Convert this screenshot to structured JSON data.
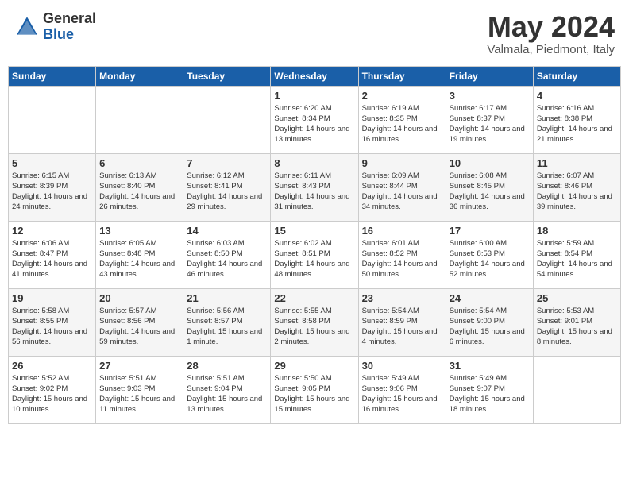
{
  "header": {
    "logo_general": "General",
    "logo_blue": "Blue",
    "month_title": "May 2024",
    "location": "Valmala, Piedmont, Italy"
  },
  "weekdays": [
    "Sunday",
    "Monday",
    "Tuesday",
    "Wednesday",
    "Thursday",
    "Friday",
    "Saturday"
  ],
  "weeks": [
    [
      {
        "day": "",
        "sunrise": "",
        "sunset": "",
        "daylight": ""
      },
      {
        "day": "",
        "sunrise": "",
        "sunset": "",
        "daylight": ""
      },
      {
        "day": "",
        "sunrise": "",
        "sunset": "",
        "daylight": ""
      },
      {
        "day": "1",
        "sunrise": "Sunrise: 6:20 AM",
        "sunset": "Sunset: 8:34 PM",
        "daylight": "Daylight: 14 hours and 13 minutes."
      },
      {
        "day": "2",
        "sunrise": "Sunrise: 6:19 AM",
        "sunset": "Sunset: 8:35 PM",
        "daylight": "Daylight: 14 hours and 16 minutes."
      },
      {
        "day": "3",
        "sunrise": "Sunrise: 6:17 AM",
        "sunset": "Sunset: 8:37 PM",
        "daylight": "Daylight: 14 hours and 19 minutes."
      },
      {
        "day": "4",
        "sunrise": "Sunrise: 6:16 AM",
        "sunset": "Sunset: 8:38 PM",
        "daylight": "Daylight: 14 hours and 21 minutes."
      }
    ],
    [
      {
        "day": "5",
        "sunrise": "Sunrise: 6:15 AM",
        "sunset": "Sunset: 8:39 PM",
        "daylight": "Daylight: 14 hours and 24 minutes."
      },
      {
        "day": "6",
        "sunrise": "Sunrise: 6:13 AM",
        "sunset": "Sunset: 8:40 PM",
        "daylight": "Daylight: 14 hours and 26 minutes."
      },
      {
        "day": "7",
        "sunrise": "Sunrise: 6:12 AM",
        "sunset": "Sunset: 8:41 PM",
        "daylight": "Daylight: 14 hours and 29 minutes."
      },
      {
        "day": "8",
        "sunrise": "Sunrise: 6:11 AM",
        "sunset": "Sunset: 8:43 PM",
        "daylight": "Daylight: 14 hours and 31 minutes."
      },
      {
        "day": "9",
        "sunrise": "Sunrise: 6:09 AM",
        "sunset": "Sunset: 8:44 PM",
        "daylight": "Daylight: 14 hours and 34 minutes."
      },
      {
        "day": "10",
        "sunrise": "Sunrise: 6:08 AM",
        "sunset": "Sunset: 8:45 PM",
        "daylight": "Daylight: 14 hours and 36 minutes."
      },
      {
        "day": "11",
        "sunrise": "Sunrise: 6:07 AM",
        "sunset": "Sunset: 8:46 PM",
        "daylight": "Daylight: 14 hours and 39 minutes."
      }
    ],
    [
      {
        "day": "12",
        "sunrise": "Sunrise: 6:06 AM",
        "sunset": "Sunset: 8:47 PM",
        "daylight": "Daylight: 14 hours and 41 minutes."
      },
      {
        "day": "13",
        "sunrise": "Sunrise: 6:05 AM",
        "sunset": "Sunset: 8:48 PM",
        "daylight": "Daylight: 14 hours and 43 minutes."
      },
      {
        "day": "14",
        "sunrise": "Sunrise: 6:03 AM",
        "sunset": "Sunset: 8:50 PM",
        "daylight": "Daylight: 14 hours and 46 minutes."
      },
      {
        "day": "15",
        "sunrise": "Sunrise: 6:02 AM",
        "sunset": "Sunset: 8:51 PM",
        "daylight": "Daylight: 14 hours and 48 minutes."
      },
      {
        "day": "16",
        "sunrise": "Sunrise: 6:01 AM",
        "sunset": "Sunset: 8:52 PM",
        "daylight": "Daylight: 14 hours and 50 minutes."
      },
      {
        "day": "17",
        "sunrise": "Sunrise: 6:00 AM",
        "sunset": "Sunset: 8:53 PM",
        "daylight": "Daylight: 14 hours and 52 minutes."
      },
      {
        "day": "18",
        "sunrise": "Sunrise: 5:59 AM",
        "sunset": "Sunset: 8:54 PM",
        "daylight": "Daylight: 14 hours and 54 minutes."
      }
    ],
    [
      {
        "day": "19",
        "sunrise": "Sunrise: 5:58 AM",
        "sunset": "Sunset: 8:55 PM",
        "daylight": "Daylight: 14 hours and 56 minutes."
      },
      {
        "day": "20",
        "sunrise": "Sunrise: 5:57 AM",
        "sunset": "Sunset: 8:56 PM",
        "daylight": "Daylight: 14 hours and 59 minutes."
      },
      {
        "day": "21",
        "sunrise": "Sunrise: 5:56 AM",
        "sunset": "Sunset: 8:57 PM",
        "daylight": "Daylight: 15 hours and 1 minute."
      },
      {
        "day": "22",
        "sunrise": "Sunrise: 5:55 AM",
        "sunset": "Sunset: 8:58 PM",
        "daylight": "Daylight: 15 hours and 2 minutes."
      },
      {
        "day": "23",
        "sunrise": "Sunrise: 5:54 AM",
        "sunset": "Sunset: 8:59 PM",
        "daylight": "Daylight: 15 hours and 4 minutes."
      },
      {
        "day": "24",
        "sunrise": "Sunrise: 5:54 AM",
        "sunset": "Sunset: 9:00 PM",
        "daylight": "Daylight: 15 hours and 6 minutes."
      },
      {
        "day": "25",
        "sunrise": "Sunrise: 5:53 AM",
        "sunset": "Sunset: 9:01 PM",
        "daylight": "Daylight: 15 hours and 8 minutes."
      }
    ],
    [
      {
        "day": "26",
        "sunrise": "Sunrise: 5:52 AM",
        "sunset": "Sunset: 9:02 PM",
        "daylight": "Daylight: 15 hours and 10 minutes."
      },
      {
        "day": "27",
        "sunrise": "Sunrise: 5:51 AM",
        "sunset": "Sunset: 9:03 PM",
        "daylight": "Daylight: 15 hours and 11 minutes."
      },
      {
        "day": "28",
        "sunrise": "Sunrise: 5:51 AM",
        "sunset": "Sunset: 9:04 PM",
        "daylight": "Daylight: 15 hours and 13 minutes."
      },
      {
        "day": "29",
        "sunrise": "Sunrise: 5:50 AM",
        "sunset": "Sunset: 9:05 PM",
        "daylight": "Daylight: 15 hours and 15 minutes."
      },
      {
        "day": "30",
        "sunrise": "Sunrise: 5:49 AM",
        "sunset": "Sunset: 9:06 PM",
        "daylight": "Daylight: 15 hours and 16 minutes."
      },
      {
        "day": "31",
        "sunrise": "Sunrise: 5:49 AM",
        "sunset": "Sunset: 9:07 PM",
        "daylight": "Daylight: 15 hours and 18 minutes."
      },
      {
        "day": "",
        "sunrise": "",
        "sunset": "",
        "daylight": ""
      }
    ]
  ]
}
